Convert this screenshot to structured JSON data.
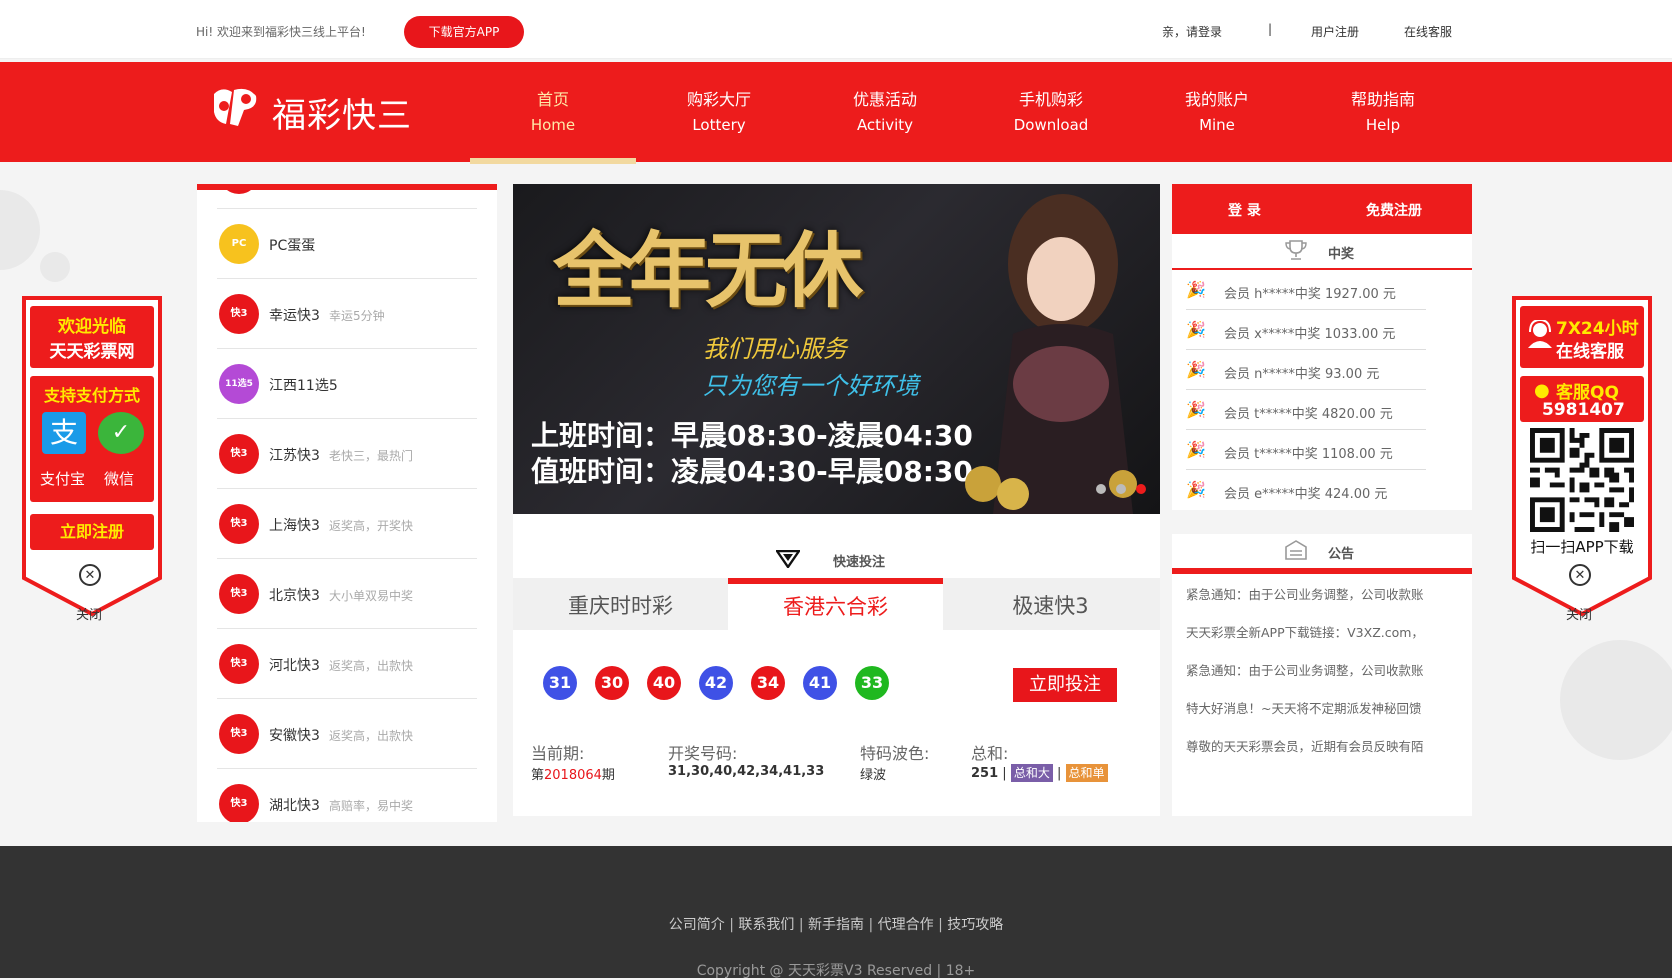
{
  "topbar": {
    "welcome": "Hi! 欢迎来到福彩快三线上平台!",
    "download_btn": "下载官方APP",
    "login": "亲，请登录",
    "separator": "|",
    "register": "用户注册",
    "service": "在线客服"
  },
  "brand": {
    "logo_icon": "fucai-logo-icon",
    "name": "福彩快三"
  },
  "nav": [
    {
      "cn": "首页",
      "en": "Home",
      "active": true
    },
    {
      "cn": "购彩大厅",
      "en": "Lottery"
    },
    {
      "cn": "优惠活动",
      "en": "Activity"
    },
    {
      "cn": "手机购彩",
      "en": "Download"
    },
    {
      "cn": "我的账户",
      "en": "Mine"
    },
    {
      "cn": "帮助指南",
      "en": "Help"
    }
  ],
  "left_float": {
    "welcome_line1": "欢迎光临",
    "welcome_line2": "天天彩票网",
    "pay_title": "支持支付方式",
    "alipay": "支付宝",
    "wechat": "微信",
    "register": "立即注册",
    "close": "关闭"
  },
  "lottery_list": [
    {
      "name": "PC蛋蛋",
      "desc": "",
      "icon": "PC"
    },
    {
      "name": "幸运快3",
      "desc": "幸运5分钟",
      "icon": "快3"
    },
    {
      "name": "江西11选5",
      "desc": "",
      "icon": "11选5"
    },
    {
      "name": "江苏快3",
      "desc": "老快三，最热门",
      "icon": "快3"
    },
    {
      "name": "上海快3",
      "desc": "返奖高，开奖快",
      "icon": "快3"
    },
    {
      "name": "北京快3",
      "desc": "大小单双易中奖",
      "icon": "快3"
    },
    {
      "name": "河北快3",
      "desc": "返奖高，出款快",
      "icon": "快3"
    },
    {
      "name": "安徽快3",
      "desc": "返奖高，出款快",
      "icon": "快3"
    },
    {
      "name": "湖北快3",
      "desc": "高赔率，易中奖",
      "icon": "快3"
    }
  ],
  "banner": {
    "title": "全年无休",
    "slogan1": "我们用心服务",
    "slogan2": "只为您有一个好环境",
    "hours1": "上班时间：早晨08:30-凌晨04:30",
    "hours2": "值班时间：凌晨04:30-早晨08:30"
  },
  "quick_bet": {
    "label": "快速投注",
    "tabs": [
      {
        "label": "重庆时时彩"
      },
      {
        "label": "香港六合彩",
        "active": true
      },
      {
        "label": "极速快3"
      }
    ],
    "balls": [
      {
        "num": "31",
        "color": "#3f51e6"
      },
      {
        "num": "30",
        "color": "#e8161b"
      },
      {
        "num": "40",
        "color": "#e8161b"
      },
      {
        "num": "42",
        "color": "#3f51e6"
      },
      {
        "num": "34",
        "color": "#e8161b"
      },
      {
        "num": "41",
        "color": "#3f51e6"
      },
      {
        "num": "33",
        "color": "#1fb81f"
      }
    ],
    "bet_button": "立即投注",
    "period_label": "当前期:",
    "period_prefix": "第",
    "period_num": "2018064",
    "period_suffix": "期",
    "numbers_label": "开奖号码:",
    "numbers": "31,30,40,42,34,41,33",
    "wave_label": "特码波色:",
    "wave": "绿波",
    "sum_label": "总和:",
    "sum": "251",
    "sum_sep": "|",
    "tag_big": "总和大",
    "tag_odd": "总和单",
    "tag_big_color": "#7a5ea8",
    "tag_odd_color": "#e8933a"
  },
  "right_col": {
    "login": "登 录",
    "register": "免费注册",
    "win_title": "中奖",
    "winners": [
      "会员 h*****中奖 1927.00 元",
      "会员 x*****中奖 1033.00 元",
      "会员 n*****中奖 93.00 元",
      "会员 t*****中奖 4820.00 元",
      "会员 t*****中奖 1108.00 元",
      "会员 e*****中奖 424.00 元"
    ],
    "notice_title": "公告",
    "notices": [
      "紧急通知：由于公司业务调整，公司收款账",
      "天天彩票全新APP下载链接：V3XZ.com，",
      "紧急通知：由于公司业务调整，公司收款账",
      "特大好消息！~天天将不定期派发神秘回馈",
      "尊敬的天天彩票会员，近期有会员反映有陌"
    ]
  },
  "right_float": {
    "service_line1": "7X24小时",
    "service_line2": "在线客服",
    "qq_label": "客服QQ",
    "qq_num": "5981407",
    "scan": "扫一扫APP下载",
    "close": "关闭"
  },
  "footer": {
    "links": [
      "公司简介",
      "联系我们",
      "新手指南",
      "代理合作",
      "技巧攻略"
    ],
    "separator": "|",
    "copyright": "Copyright @ 天天彩票V3 Reserved | 18+"
  },
  "colors": {
    "brand_red": "#ed1c1c",
    "button_red": "#e8161b",
    "footer_bg": "#333333"
  }
}
